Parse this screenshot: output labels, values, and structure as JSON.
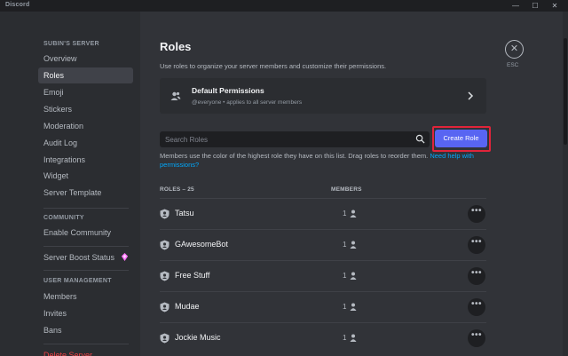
{
  "window": {
    "title": "Discord",
    "minimize": "—",
    "maximize": "☐",
    "close": "✕"
  },
  "sidebar": {
    "server_header": "SUBIN'S SERVER",
    "server_items": [
      {
        "label": "Overview"
      },
      {
        "label": "Roles"
      },
      {
        "label": "Emoji"
      },
      {
        "label": "Stickers"
      },
      {
        "label": "Moderation"
      },
      {
        "label": "Audit Log"
      },
      {
        "label": "Integrations"
      },
      {
        "label": "Widget"
      },
      {
        "label": "Server Template"
      }
    ],
    "community_header": "COMMUNITY",
    "community_items": [
      {
        "label": "Enable Community"
      }
    ],
    "boost_item": {
      "label": "Server Boost Status"
    },
    "user_mgmt_header": "USER MANAGEMENT",
    "user_mgmt_items": [
      {
        "label": "Members"
      },
      {
        "label": "Invites"
      },
      {
        "label": "Bans"
      }
    ],
    "delete_label": "Delete Server",
    "active_item": "Roles"
  },
  "main": {
    "title": "Roles",
    "description": "Use roles to organize your server members and customize their permissions.",
    "close_glyph": "✕",
    "esc_label": "ESC",
    "default_permissions": {
      "title": "Default Permissions",
      "subtitle": "@everyone • applies to all server members"
    },
    "search": {
      "placeholder": "Search Roles",
      "value": ""
    },
    "create_role_label": "Create Role",
    "help_text": "Members use the color of the highest role they have on this list. Drag roles to reorder them.",
    "help_link": "Need help with permissions?",
    "table": {
      "roles_header": "ROLES – 25",
      "members_header": "MEMBERS",
      "more_glyph": "•••",
      "rows": [
        {
          "name": "Tatsu",
          "members": "1"
        },
        {
          "name": "GAwesomeBot",
          "members": "1"
        },
        {
          "name": "Free Stuff",
          "members": "1"
        },
        {
          "name": "Mudae",
          "members": "1"
        },
        {
          "name": "Jockie Music",
          "members": "1"
        }
      ]
    }
  },
  "colors": {
    "accent": "#5865f2",
    "highlight": "#e0243a",
    "link": "#00a8fc",
    "danger": "#f23f43",
    "boost": "#ff73fa"
  },
  "icons": {
    "close": "close-icon",
    "default_permissions": "members-group-icon",
    "chevron": "chevron-right-icon",
    "search": "search-icon",
    "role": "shield-icon",
    "member": "person-icon",
    "more": "more-options-icon",
    "boost": "boost-gem-icon"
  }
}
